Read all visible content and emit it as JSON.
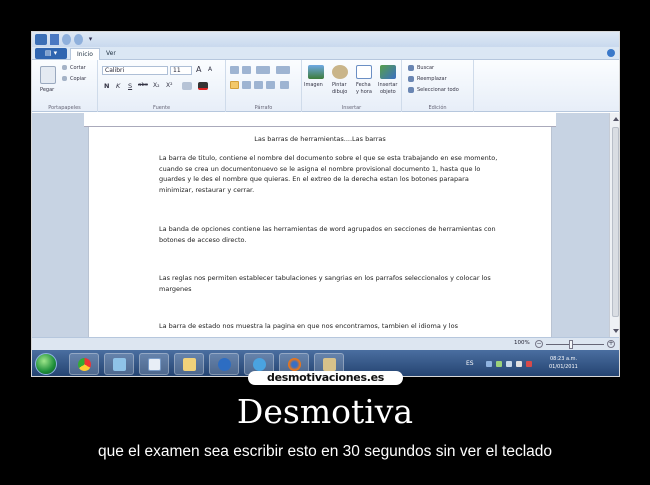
{
  "ribbon": {
    "file_button": "",
    "tabs": [
      {
        "label": "Inicio",
        "active": true
      },
      {
        "label": "Ver",
        "active": false
      }
    ],
    "clipboard": {
      "paste": "Pegar",
      "cut": "Cortar",
      "copy": "Copiar",
      "group_label": "Portapapeles"
    },
    "font": {
      "family": "Calibri",
      "size": "11",
      "grow": "A",
      "shrink": "A",
      "bold": "N",
      "italic": "K",
      "underline": "S",
      "strike": "abc",
      "subscript": "X₂",
      "superscript": "X²",
      "group_label": "Fuente"
    },
    "paragraph": {
      "group_label": "Párrafo"
    },
    "insert": {
      "images": "Imagen",
      "paint_l1": "Pintar",
      "paint_l2": "dibujo",
      "date_l1": "Fecha",
      "date_l2": "y hora",
      "object_l1": "Insertar",
      "object_l2": "objeto",
      "group_label": "Insertar"
    },
    "editing": {
      "find": "Buscar",
      "replace": "Reemplazar",
      "select_all": "Seleccionar todo",
      "group_label": "Edición"
    }
  },
  "document": {
    "title": "Las barras de herramientas....Las barras",
    "paragraphs": [
      "La barra de titulo, contiene el nombre del documento sobre el que se esta trabajando en ese momento, cuando se crea un documentonuevo se le asigna el nombre provisional documento 1, hasta que lo guardes y le des el nombre que quieras. En el extreo de la derecha estan los botones parapara minimizar, restaurar y cerrar.",
      "La banda de opciones contiene las herramientas de word agrupados en secciones de herramientas con botones de acceso directo.",
      "Las reglas nos permiten  establecer tabulaciones y sangrias en los parrafos seleccionalos  y colocar los margenes",
      "La barra de estado nos muestra la pagina en que nos encontramos, tambien el idioma y los"
    ]
  },
  "statusbar": {
    "zoom": "100%",
    "zoom_minus": "−",
    "zoom_plus": "+",
    "zoom_fraction": 0.43
  },
  "taskbar": {
    "lang": "ES",
    "time": "08:23 a.m.",
    "date": "01/01/2011"
  },
  "watermark": {
    "site": "desmotivaciones.es"
  },
  "caption": {
    "title": "Desmotiva",
    "subtitle": "que el examen sea escribir esto en 30 segundos sin ver el teclado"
  }
}
